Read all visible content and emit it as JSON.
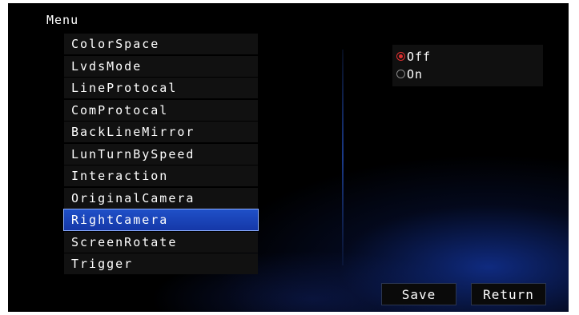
{
  "menu": {
    "title": "Menu",
    "items": [
      {
        "label": "ColorSpace",
        "selected": false
      },
      {
        "label": "LvdsMode",
        "selected": false
      },
      {
        "label": "LineProtocal",
        "selected": false
      },
      {
        "label": "ComProtocal",
        "selected": false
      },
      {
        "label": "BackLineMirror",
        "selected": false
      },
      {
        "label": "LunTurnBySpeed",
        "selected": false
      },
      {
        "label": "Interaction",
        "selected": false
      },
      {
        "label": "OriginalCamera",
        "selected": false
      },
      {
        "label": "RightCamera",
        "selected": true
      },
      {
        "label": "ScreenRotate",
        "selected": false
      },
      {
        "label": "Trigger",
        "selected": false
      }
    ]
  },
  "options": [
    {
      "label": "Off",
      "checked": true
    },
    {
      "label": "On",
      "checked": false
    }
  ],
  "buttons": {
    "save": "Save",
    "return": "Return"
  },
  "colors": {
    "background": "#000000",
    "selection": "#1f50c8",
    "radio_checked": "#e03030"
  }
}
